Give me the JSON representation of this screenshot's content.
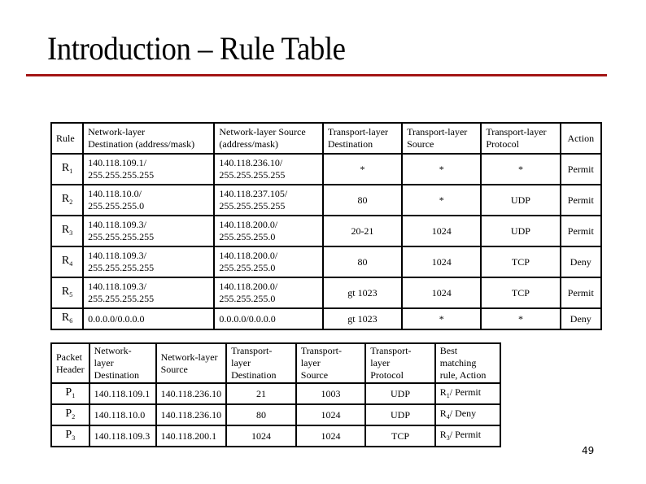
{
  "slide": {
    "title": "Introduction – Rule Table",
    "page_number": "49",
    "accent_color": "#a31515"
  },
  "rule_table": {
    "headers": [
      "Rule",
      "Network-layer Destination (address/mask)",
      "Network-layer Source (address/mask)",
      "Transport-layer Destination",
      "Transport-layer Source",
      "Transport-layer Protocol",
      "Action"
    ],
    "rows": [
      {
        "rule": "R",
        "sub": "1",
        "net_dst": [
          "140.118.109.1/",
          "255.255.255.255"
        ],
        "net_src": [
          "140.118.236.10/",
          "255.255.255.255"
        ],
        "tr_dst": "*",
        "tr_src": "*",
        "proto": "*",
        "action": "Permit"
      },
      {
        "rule": "R",
        "sub": "2",
        "net_dst": [
          "140.118.10.0/",
          "255.255.255.0"
        ],
        "net_src": [
          "140.118.237.105/",
          "255.255.255.255"
        ],
        "tr_dst": "80",
        "tr_src": "*",
        "proto": "UDP",
        "action": "Permit"
      },
      {
        "rule": "R",
        "sub": "3",
        "net_dst": [
          "140.118.109.3/",
          "255.255.255.255"
        ],
        "net_src": [
          "140.118.200.0/",
          "255.255.255.0"
        ],
        "tr_dst": "20-21",
        "tr_src": "1024",
        "proto": "UDP",
        "action": "Permit"
      },
      {
        "rule": "R",
        "sub": "4",
        "net_dst": [
          "140.118.109.3/",
          "255.255.255.255"
        ],
        "net_src": [
          "140.118.200.0/",
          "255.255.255.0"
        ],
        "tr_dst": "80",
        "tr_src": "1024",
        "proto": "TCP",
        "action": "Deny"
      },
      {
        "rule": "R",
        "sub": "5",
        "net_dst": [
          "140.118.109.3/",
          "255.255.255.255"
        ],
        "net_src": [
          "140.118.200.0/",
          "255.255.255.0"
        ],
        "tr_dst": "gt 1023",
        "tr_src": "1024",
        "proto": "TCP",
        "action": "Permit"
      },
      {
        "rule": "R",
        "sub": "6",
        "net_dst": [
          "0.0.0.0/0.0.0.0",
          ""
        ],
        "net_src": [
          "0.0.0.0/0.0.0.0",
          ""
        ],
        "tr_dst": "gt 1023",
        "tr_src": "*",
        "proto": "*",
        "action": "Deny"
      }
    ]
  },
  "packet_table": {
    "headers": [
      "Packet Header",
      "Network-layer Destination",
      "Network-layer Source",
      "Transport-layer Destination",
      "Transport-layer Source",
      "Transport-layer Protocol",
      "Best matching rule, Action"
    ],
    "header_lines": [
      [
        "Packet",
        "Header"
      ],
      [
        "Network-layer",
        "Destination"
      ],
      [
        "Network-layer",
        "Source"
      ],
      [
        "Transport-layer",
        "Destination"
      ],
      [
        "Transport-layer",
        "Source"
      ],
      [
        "Transport-layer",
        "Protocol"
      ],
      [
        "Best matching",
        "rule, Action"
      ]
    ],
    "rows": [
      {
        "packet": "P",
        "sub": "1",
        "net_dst": "140.118.109.1",
        "net_src": "140.118.236.10",
        "tr_dst": "21",
        "tr_src": "1003",
        "proto": "UDP",
        "match_rule": "R",
        "match_sub": "1",
        "match_action": "/ Permit"
      },
      {
        "packet": "P",
        "sub": "2",
        "net_dst": "140.118.10.0",
        "net_src": "140.118.236.10",
        "tr_dst": "80",
        "tr_src": "1024",
        "proto": "UDP",
        "match_rule": "R",
        "match_sub": "4",
        "match_action": "/ Deny"
      },
      {
        "packet": "P",
        "sub": "3",
        "net_dst": "140.118.109.3",
        "net_src": "140.118.200.1",
        "tr_dst": "1024",
        "tr_src": "1024",
        "proto": "TCP",
        "match_rule": "R",
        "match_sub": "3",
        "match_action": "/ Permit"
      }
    ]
  },
  "rule_header_lines": [
    [
      "Rule"
    ],
    [
      "Network-layer",
      "Destination (address/mask)"
    ],
    [
      "Network-layer Source",
      "(address/mask)"
    ],
    [
      "Transport-layer",
      "Destination"
    ],
    [
      "Transport-layer",
      "Source"
    ],
    [
      "Transport-layer",
      "Protocol"
    ],
    [
      "Action"
    ]
  ]
}
